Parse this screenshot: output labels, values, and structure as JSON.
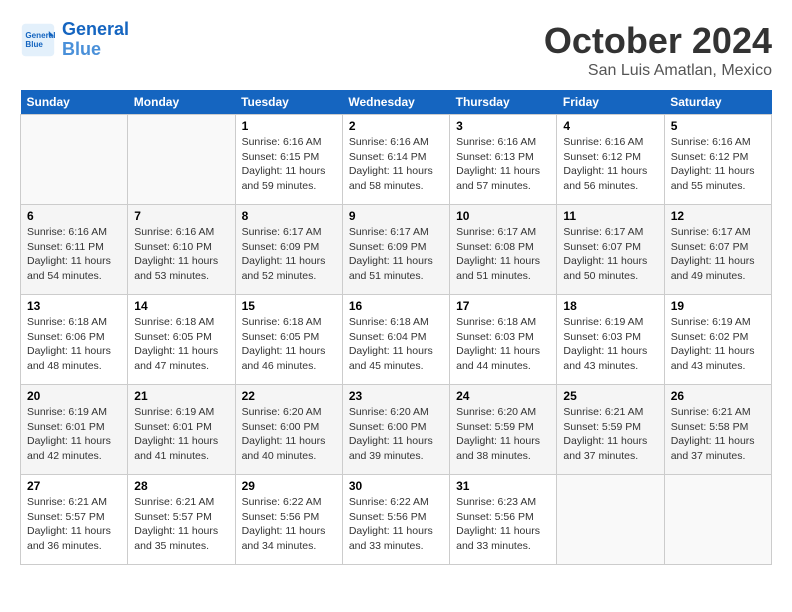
{
  "header": {
    "logo_line1": "General",
    "logo_line2": "Blue",
    "month": "October 2024",
    "location": "San Luis Amatlan, Mexico"
  },
  "days_of_week": [
    "Sunday",
    "Monday",
    "Tuesday",
    "Wednesday",
    "Thursday",
    "Friday",
    "Saturday"
  ],
  "weeks": [
    [
      null,
      null,
      {
        "day": 1,
        "sunrise": "6:16 AM",
        "sunset": "6:15 PM",
        "daylight": "11 hours and 59 minutes."
      },
      {
        "day": 2,
        "sunrise": "6:16 AM",
        "sunset": "6:14 PM",
        "daylight": "11 hours and 58 minutes."
      },
      {
        "day": 3,
        "sunrise": "6:16 AM",
        "sunset": "6:13 PM",
        "daylight": "11 hours and 57 minutes."
      },
      {
        "day": 4,
        "sunrise": "6:16 AM",
        "sunset": "6:12 PM",
        "daylight": "11 hours and 56 minutes."
      },
      {
        "day": 5,
        "sunrise": "6:16 AM",
        "sunset": "6:12 PM",
        "daylight": "11 hours and 55 minutes."
      }
    ],
    [
      {
        "day": 6,
        "sunrise": "6:16 AM",
        "sunset": "6:11 PM",
        "daylight": "11 hours and 54 minutes."
      },
      {
        "day": 7,
        "sunrise": "6:16 AM",
        "sunset": "6:10 PM",
        "daylight": "11 hours and 53 minutes."
      },
      {
        "day": 8,
        "sunrise": "6:17 AM",
        "sunset": "6:09 PM",
        "daylight": "11 hours and 52 minutes."
      },
      {
        "day": 9,
        "sunrise": "6:17 AM",
        "sunset": "6:09 PM",
        "daylight": "11 hours and 51 minutes."
      },
      {
        "day": 10,
        "sunrise": "6:17 AM",
        "sunset": "6:08 PM",
        "daylight": "11 hours and 51 minutes."
      },
      {
        "day": 11,
        "sunrise": "6:17 AM",
        "sunset": "6:07 PM",
        "daylight": "11 hours and 50 minutes."
      },
      {
        "day": 12,
        "sunrise": "6:17 AM",
        "sunset": "6:07 PM",
        "daylight": "11 hours and 49 minutes."
      }
    ],
    [
      {
        "day": 13,
        "sunrise": "6:18 AM",
        "sunset": "6:06 PM",
        "daylight": "11 hours and 48 minutes."
      },
      {
        "day": 14,
        "sunrise": "6:18 AM",
        "sunset": "6:05 PM",
        "daylight": "11 hours and 47 minutes."
      },
      {
        "day": 15,
        "sunrise": "6:18 AM",
        "sunset": "6:05 PM",
        "daylight": "11 hours and 46 minutes."
      },
      {
        "day": 16,
        "sunrise": "6:18 AM",
        "sunset": "6:04 PM",
        "daylight": "11 hours and 45 minutes."
      },
      {
        "day": 17,
        "sunrise": "6:18 AM",
        "sunset": "6:03 PM",
        "daylight": "11 hours and 44 minutes."
      },
      {
        "day": 18,
        "sunrise": "6:19 AM",
        "sunset": "6:03 PM",
        "daylight": "11 hours and 43 minutes."
      },
      {
        "day": 19,
        "sunrise": "6:19 AM",
        "sunset": "6:02 PM",
        "daylight": "11 hours and 43 minutes."
      }
    ],
    [
      {
        "day": 20,
        "sunrise": "6:19 AM",
        "sunset": "6:01 PM",
        "daylight": "11 hours and 42 minutes."
      },
      {
        "day": 21,
        "sunrise": "6:19 AM",
        "sunset": "6:01 PM",
        "daylight": "11 hours and 41 minutes."
      },
      {
        "day": 22,
        "sunrise": "6:20 AM",
        "sunset": "6:00 PM",
        "daylight": "11 hours and 40 minutes."
      },
      {
        "day": 23,
        "sunrise": "6:20 AM",
        "sunset": "6:00 PM",
        "daylight": "11 hours and 39 minutes."
      },
      {
        "day": 24,
        "sunrise": "6:20 AM",
        "sunset": "5:59 PM",
        "daylight": "11 hours and 38 minutes."
      },
      {
        "day": 25,
        "sunrise": "6:21 AM",
        "sunset": "5:59 PM",
        "daylight": "11 hours and 37 minutes."
      },
      {
        "day": 26,
        "sunrise": "6:21 AM",
        "sunset": "5:58 PM",
        "daylight": "11 hours and 37 minutes."
      }
    ],
    [
      {
        "day": 27,
        "sunrise": "6:21 AM",
        "sunset": "5:57 PM",
        "daylight": "11 hours and 36 minutes."
      },
      {
        "day": 28,
        "sunrise": "6:21 AM",
        "sunset": "5:57 PM",
        "daylight": "11 hours and 35 minutes."
      },
      {
        "day": 29,
        "sunrise": "6:22 AM",
        "sunset": "5:56 PM",
        "daylight": "11 hours and 34 minutes."
      },
      {
        "day": 30,
        "sunrise": "6:22 AM",
        "sunset": "5:56 PM",
        "daylight": "11 hours and 33 minutes."
      },
      {
        "day": 31,
        "sunrise": "6:23 AM",
        "sunset": "5:56 PM",
        "daylight": "11 hours and 33 minutes."
      },
      null,
      null
    ]
  ]
}
